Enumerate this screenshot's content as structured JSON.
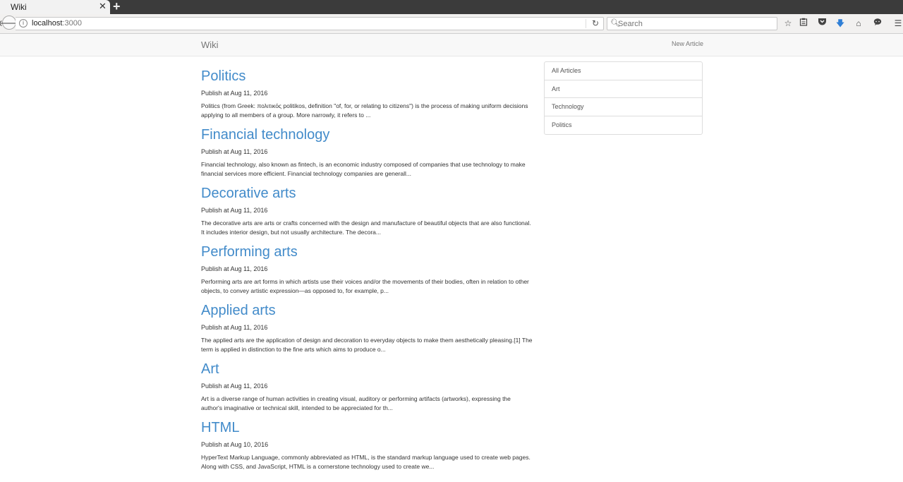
{
  "browser": {
    "tab_title": "Wiki",
    "url_host": "localhost",
    "url_port": ":3000",
    "search_placeholder": "Search"
  },
  "site": {
    "brand": "Wiki",
    "new_article": "New Article"
  },
  "sidebar": {
    "items": [
      {
        "label": "All Articles"
      },
      {
        "label": "Art"
      },
      {
        "label": "Technology"
      },
      {
        "label": "Politics"
      }
    ]
  },
  "articles": [
    {
      "title": "Politics",
      "date": "Publish at Aug 11, 2016",
      "excerpt": "Politics (from Greek: πολιτικός politikos, definition \"of, for, or relating to citizens\") is the process of making uniform decisions applying to all members of a group. More narrowly, it refers to ..."
    },
    {
      "title": "Financial technology",
      "date": "Publish at Aug 11, 2016",
      "excerpt": "Financial technology, also known as fintech, is an economic industry composed of companies that use technology to make financial services more efficient. Financial technology companies are generall..."
    },
    {
      "title": "Decorative arts",
      "date": "Publish at Aug 11, 2016",
      "excerpt": "The decorative arts are arts or crafts concerned with the design and manufacture of beautiful objects that are also functional. It includes interior design, but not usually architecture. The decora..."
    },
    {
      "title": "Performing arts",
      "date": "Publish at Aug 11, 2016",
      "excerpt": "Performing arts are art forms in which artists use their voices and/or the movements of their bodies, often in relation to other objects, to convey artistic expression—as opposed to, for example, p..."
    },
    {
      "title": "Applied arts",
      "date": "Publish at Aug 11, 2016",
      "excerpt": "The applied arts are the application of design and decoration to everyday objects to make them aesthetically pleasing.[1] The term is applied in distinction to the fine arts which aims to produce o..."
    },
    {
      "title": "Art",
      "date": "Publish at Aug 11, 2016",
      "excerpt": "Art is a diverse range of human activities in creating visual, auditory or performing artifacts (artworks), expressing the author's imaginative or technical skill, intended to be appreciated for th..."
    },
    {
      "title": "HTML",
      "date": "Publish at Aug 10, 2016",
      "excerpt": "HyperText Markup Language, commonly abbreviated as HTML, is the standard markup language used to create web pages. Along with CSS, and JavaScript, HTML is a cornerstone technology used to create we..."
    }
  ],
  "colors": {
    "link": "#428bca",
    "text": "#333333",
    "muted": "#777777"
  }
}
